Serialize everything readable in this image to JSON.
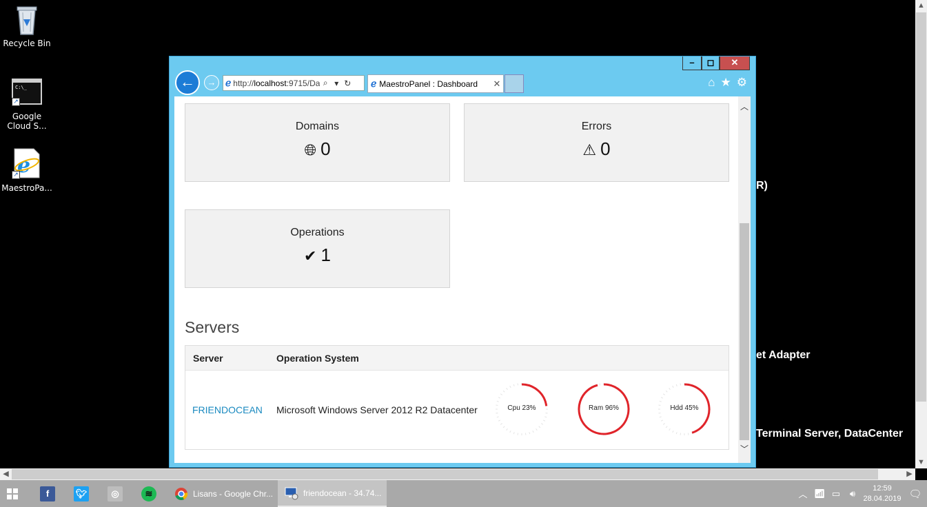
{
  "desktop": {
    "icons": [
      {
        "label": "Recycle Bin"
      },
      {
        "label": "Google Cloud S..."
      },
      {
        "label": "MaestroPa..."
      }
    ],
    "background_text": [
      "R)",
      "et Adapter",
      "Terminal Server, DataCenter"
    ]
  },
  "browser": {
    "address": "http://localhost:9715/Da",
    "address_prefix": "http://",
    "address_host": "localhost",
    "address_rest": ":9715/Da",
    "tab_title": "MaestroPanel : Dashboard",
    "controls": {
      "minimize": "–",
      "maximize": "◻",
      "close": "✕"
    }
  },
  "dashboard": {
    "cards": {
      "domains": {
        "title": "Domains",
        "value": "0",
        "icon": "globe-icon"
      },
      "errors": {
        "title": "Errors",
        "value": "0",
        "icon": "warning-icon"
      },
      "operations": {
        "title": "Operations",
        "value": "1",
        "icon": "check-icon"
      }
    },
    "servers": {
      "heading": "Servers",
      "columns": [
        "Server",
        "Operation System"
      ],
      "rows": [
        {
          "server": "FRIENDOCEAN",
          "os": "Microsoft Windows Server 2012 R2 Datacenter",
          "gauges": [
            {
              "label": "Cpu 23%",
              "percent": 23,
              "color": "#e0242a"
            },
            {
              "label": "Ram 96%",
              "percent": 96,
              "color": "#e0242a"
            },
            {
              "label": "Hdd 45%",
              "percent": 45,
              "color": "#e0242a"
            }
          ]
        }
      ]
    }
  },
  "taskbar": {
    "items": [
      {
        "label": "Lisans - Google Chr..."
      },
      {
        "label": "friendocean - 34.74..."
      }
    ],
    "clock": {
      "time": "12:59",
      "date": "28.04.2019"
    }
  }
}
